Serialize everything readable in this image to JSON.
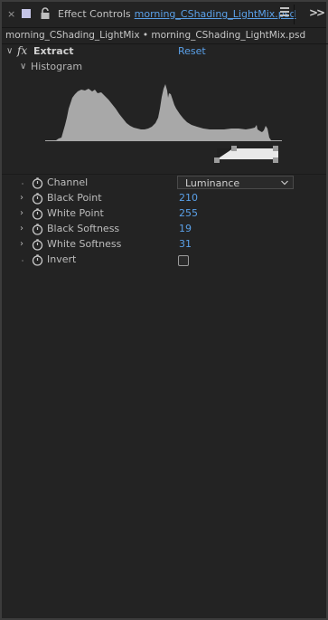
{
  "header": {
    "close_glyph": "×",
    "panel_title": "Effect Controls",
    "file_name": "morning_CShading_LightMix.psd",
    "more_glyph": ">>"
  },
  "layer_path": "morning_CShading_LightMix • morning_CShading_LightMix.psd",
  "effect": {
    "fx_glyph": "fx",
    "name": "Extract",
    "reset_label": "Reset"
  },
  "histogram": {
    "label": "Histogram",
    "black_point_fraction": 0.82,
    "white_point_fraction": 1.0
  },
  "params": {
    "channel": {
      "label": "Channel",
      "value": "Luminance"
    },
    "black_point": {
      "label": "Black Point",
      "value": "210"
    },
    "white_point": {
      "label": "White Point",
      "value": "255"
    },
    "black_softness": {
      "label": "Black Softness",
      "value": "19"
    },
    "white_softness": {
      "label": "White Softness",
      "value": "31"
    },
    "invert": {
      "label": "Invert",
      "checked": false
    }
  },
  "colors": {
    "accent": "#5aa0e8",
    "panel_bg": "#232323",
    "histogram_fill": "#a8a8a8"
  }
}
